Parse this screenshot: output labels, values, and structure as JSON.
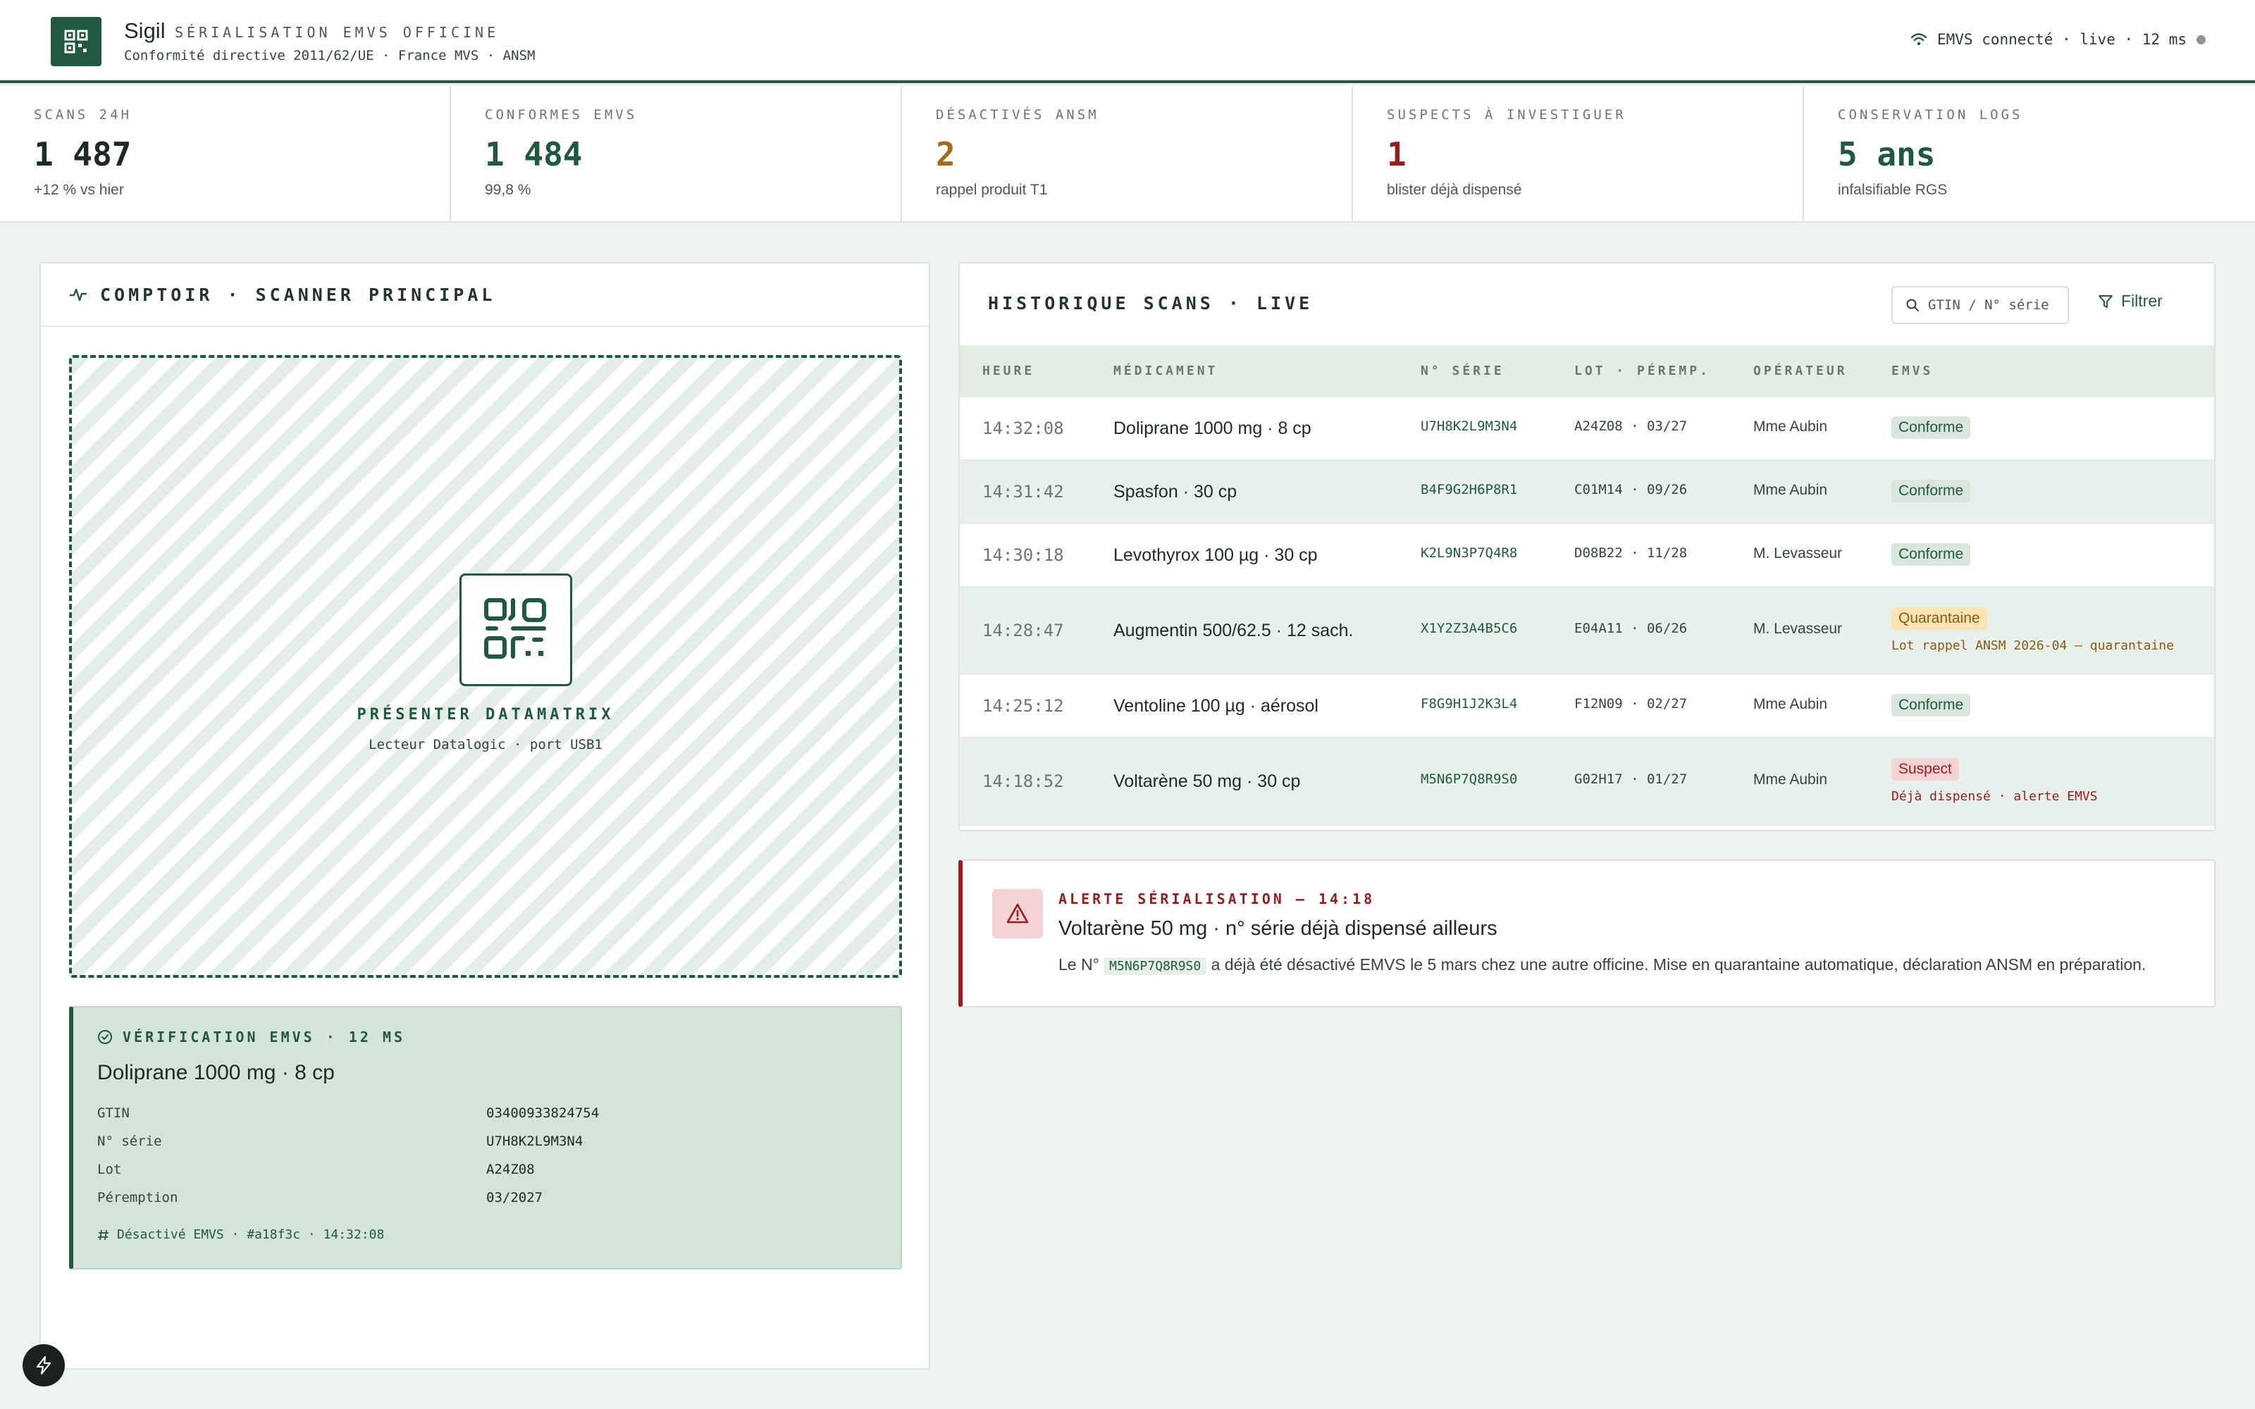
{
  "header": {
    "brand": "Sigil",
    "brand_sub": "SÉRIALISATION EMVS OFFICINE",
    "compliance": "Conformité directive 2011/62/UE · France MVS · ANSM",
    "connection": "EMVS connecté · live · 12 ms"
  },
  "stats": [
    {
      "label": "SCANS 24H",
      "value": "1 487",
      "note": "+12 % vs hier",
      "color": "#1c2b24"
    },
    {
      "label": "CONFORMES EMVS",
      "value": "1 484",
      "note": "99,8 %",
      "color": "#1f5a40"
    },
    {
      "label": "DÉSACTIVÉS ANSM",
      "value": "2",
      "note": "rappel produit T1",
      "color": "#a86a12"
    },
    {
      "label": "SUSPECTS À INVESTIGUER",
      "value": "1",
      "note": "blister déjà dispensé",
      "color": "#9b1c1c"
    },
    {
      "label": "CONSERVATION LOGS",
      "value": "5 ans",
      "note": "infalsifiable RGS",
      "color": "#1f5a40"
    }
  ],
  "scanner": {
    "title": "COMPTOIR · SCANNER PRINCIPAL",
    "prompt_title": "PRÉSENTER DATAMATRIX",
    "prompt_sub": "Lecteur Datalogic · port USB1"
  },
  "verification": {
    "title": "VÉRIFICATION EMVS · 12 MS",
    "product": "Doliprane 1000 mg · 8 cp",
    "fields": [
      {
        "key": "GTIN",
        "value": "03400933824754"
      },
      {
        "key": "N° série",
        "value": "U7H8K2L9M3N4"
      },
      {
        "key": "Lot",
        "value": "A24Z08"
      },
      {
        "key": "Péremption",
        "value": "03/2027"
      }
    ],
    "footer": "Désactivé EMVS · #a18f3c · 14:32:08"
  },
  "history": {
    "title": "HISTORIQUE SCANS · LIVE",
    "search_placeholder": "GTIN / N° série",
    "filter_label": "Filtrer",
    "columns": [
      "HEURE",
      "MÉDICAMENT",
      "N° SÉRIE",
      "LOT · PÉREMP.",
      "OPÉRATEUR",
      "EMVS"
    ],
    "rows": [
      {
        "time": "14:32:08",
        "med": "Doliprane 1000 mg · 8 cp",
        "serial": "U7H8K2L9M3N4",
        "lot": "A24Z08 · 03/27",
        "op": "Mme Aubin",
        "status": "Conforme",
        "kind": "ok",
        "note": ""
      },
      {
        "time": "14:31:42",
        "med": "Spasfon · 30 cp",
        "serial": "B4F9G2H6P8R1",
        "lot": "C01M14 · 09/26",
        "op": "Mme Aubin",
        "status": "Conforme",
        "kind": "ok",
        "note": ""
      },
      {
        "time": "14:30:18",
        "med": "Levothyrox 100 µg · 30 cp",
        "serial": "K2L9N3P7Q4R8",
        "lot": "D08B22 · 11/28",
        "op": "M. Levasseur",
        "status": "Conforme",
        "kind": "ok",
        "note": ""
      },
      {
        "time": "14:28:47",
        "med": "Augmentin 500/62.5 · 12 sach.",
        "serial": "X1Y2Z3A4B5C6",
        "lot": "E04A11 · 06/26",
        "op": "M. Levasseur",
        "status": "Quarantaine",
        "kind": "q",
        "note": "Lot rappel ANSM 2026-04 — quarantaine"
      },
      {
        "time": "14:25:12",
        "med": "Ventoline 100 µg · aérosol",
        "serial": "F8G9H1J2K3L4",
        "lot": "F12N09 · 02/27",
        "op": "Mme Aubin",
        "status": "Conforme",
        "kind": "ok",
        "note": ""
      },
      {
        "time": "14:18:52",
        "med": "Voltarène 50 mg · 30 cp",
        "serial": "M5N6P7Q8R9S0",
        "lot": "G02H17 · 01/27",
        "op": "Mme Aubin",
        "status": "Suspect",
        "kind": "s",
        "note": "Déjà dispensé · alerte EMVS"
      }
    ]
  },
  "alert": {
    "label": "ALERTE SÉRIALISATION — 14:18",
    "title": "Voltarène 50 mg · n° série déjà dispensé ailleurs",
    "text_before": "Le N°",
    "code": "M5N6P7Q8R9S0",
    "text_after": "a déjà été désactivé EMVS le 5 mars chez une autre officine. Mise en quarantaine automatique, déclaration ANSM en préparation."
  }
}
